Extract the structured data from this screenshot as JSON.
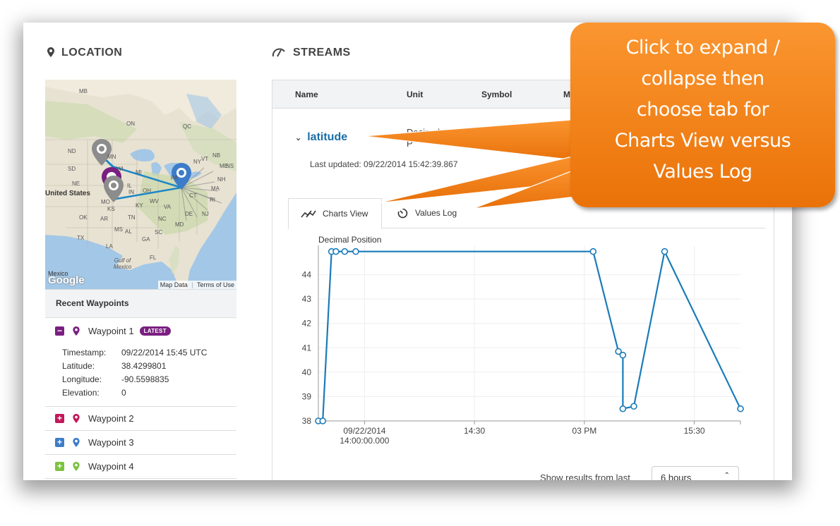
{
  "location": {
    "title": "LOCATION"
  },
  "streams": {
    "title": "STREAMS"
  },
  "map": {
    "labels": [
      "MB",
      "ON",
      "QC",
      "ND",
      "MN",
      "SD",
      "NE",
      "United States",
      "MO",
      "KS",
      "OK",
      "AR",
      "TX",
      "LA",
      "MS",
      "AL",
      "GA",
      "FL",
      "TN",
      "KY",
      "IL",
      "IN",
      "OH",
      "MI",
      "WI",
      "PA",
      "NY",
      "VT",
      "ME",
      "NB",
      "NS",
      "NH",
      "MA",
      "CT",
      "RI",
      "NJ",
      "DE",
      "MD",
      "VA",
      "WV",
      "NC",
      "SC",
      "Gulf of Mexico",
      "Mexico"
    ],
    "google": "Google",
    "map_data": "Map Data",
    "terms": "Terms of Use"
  },
  "waypoints": {
    "header": "Recent Waypoints",
    "items": [
      {
        "name": "Waypoint 1",
        "badge": "LATEST",
        "toggle": "−",
        "color": "#7a1f80",
        "fields": [
          {
            "k": "Timestamp:",
            "v": "09/22/2014 15:45 UTC"
          },
          {
            "k": "Latitude:",
            "v": "38.4299801"
          },
          {
            "k": "Longitude:",
            "v": "-90.5598835"
          },
          {
            "k": "Elevation:",
            "v": "0"
          }
        ]
      },
      {
        "name": "Waypoint 2",
        "toggle": "+",
        "color": "#c2185b"
      },
      {
        "name": "Waypoint 3",
        "toggle": "+",
        "color": "#3d7cc9"
      },
      {
        "name": "Waypoint 4",
        "toggle": "+",
        "color": "#7cc242"
      }
    ]
  },
  "table": {
    "headers": [
      "Name",
      "Unit",
      "Symbol",
      "M"
    ],
    "stream_name": "latitude",
    "unit_partial": "Decimal",
    "unit_partial2": "P",
    "last_updated": "Last updated: 09/22/2014 15:42:39.867"
  },
  "tabs": [
    {
      "label": "Charts View",
      "icon": "chart-line-icon",
      "active": true
    },
    {
      "label": "Values Log",
      "icon": "timer-icon",
      "active": false
    }
  ],
  "chart_data": {
    "type": "line",
    "series_label": "Decimal Position",
    "ylim": [
      38,
      45
    ],
    "yticks": [
      38,
      39,
      40,
      41,
      42,
      43,
      44
    ],
    "xticks": [
      {
        "x": 14.0,
        "label": "09/22/2014",
        "label2": "14:00:00.000"
      },
      {
        "x": 14.5,
        "label": "14:30"
      },
      {
        "x": 15.0,
        "label": "03 PM"
      },
      {
        "x": 15.5,
        "label": "15:30"
      }
    ],
    "xlim": [
      13.79,
      15.71
    ],
    "grid": true,
    "points": [
      [
        13.79,
        38.0
      ],
      [
        13.81,
        38.0
      ],
      [
        13.85,
        44.95
      ],
      [
        13.87,
        44.95
      ],
      [
        13.91,
        44.95
      ],
      [
        13.96,
        44.95
      ],
      [
        15.04,
        44.95
      ],
      [
        15.155,
        40.85
      ],
      [
        15.175,
        40.7
      ],
      [
        15.175,
        38.5
      ],
      [
        15.225,
        38.6
      ],
      [
        15.365,
        44.95
      ],
      [
        15.71,
        38.5
      ]
    ],
    "color": "#1a7bb9"
  },
  "footer": {
    "show_results": "Show results from last",
    "range_value": "6 hours"
  },
  "callout": {
    "lines": [
      "Click to expand /",
      "collapse then",
      "choose tab for",
      "Charts View versus",
      "Values Log"
    ]
  }
}
